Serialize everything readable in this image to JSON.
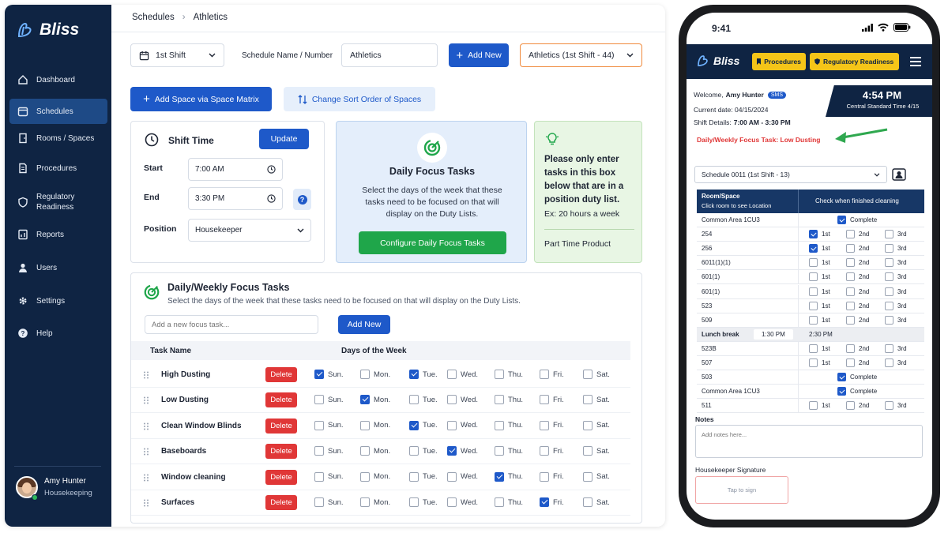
{
  "app": {
    "name": "Bliss",
    "nav": [
      {
        "label": "Dashboard",
        "icon": "dashboard-icon"
      },
      {
        "label": "Schedules",
        "icon": "calendar-icon",
        "active": true
      },
      {
        "label": "Rooms / Spaces",
        "icon": "door-icon"
      },
      {
        "label": "Procedures",
        "icon": "document-icon"
      },
      {
        "label": "Regulatory Readiness",
        "icon": "shield-icon"
      },
      {
        "label": "Reports",
        "icon": "reports-icon"
      },
      {
        "label": "Users",
        "icon": "user-icon"
      },
      {
        "label": "Settings",
        "icon": "gear-icon"
      },
      {
        "label": "Help",
        "icon": "help-icon"
      }
    ],
    "user": {
      "name": "Amy Hunter",
      "role": "Housekeeping"
    }
  },
  "main": {
    "breadcrumb": [
      "Schedules",
      "Athletics"
    ],
    "shift_select": "1st Shift",
    "schedule_label": "Schedule Name / Number",
    "schedule_value": "Athletics",
    "add_new": "Add New",
    "schedule_select": "Athletics (1st Shift - 44)",
    "add_space": "Add Space via Space Matrix",
    "sort_order": "Change Sort Order of Spaces",
    "shift_time": {
      "title": "Shift Time",
      "update": "Update",
      "start_label": "Start",
      "start": "7:00 AM",
      "end_label": "End",
      "end": "3:30 PM",
      "position_label": "Position",
      "position": "Housekeeper"
    },
    "daily_focus": {
      "title": "Daily Focus Tasks",
      "desc": "Select the days of the week that these tasks need to be focused on that will display on the Duty Lists.",
      "button": "Configure Daily Focus Tasks"
    },
    "tip": {
      "text": "Please only enter tasks in this box below that are in a position duty list.",
      "example": "Ex: 20 hours a week",
      "product": "Part Time Product"
    },
    "weekly": {
      "title": "Daily/Weekly Focus Tasks",
      "desc": "Select the days of the week that these tasks need to be focused on that will display on the Duty Lists.",
      "placeholder": "Add a new focus task...",
      "add": "Add New",
      "col_task": "Task Name",
      "col_days": "Days of the Week",
      "days": [
        "Sun.",
        "Mon.",
        "Tue.",
        "Wed.",
        "Thu.",
        "Fri.",
        "Sat."
      ],
      "delete": "Delete",
      "tasks": [
        {
          "name": "High Dusting",
          "checked": [
            0,
            2
          ]
        },
        {
          "name": "Low Dusting",
          "checked": [
            1
          ]
        },
        {
          "name": "Clean Window Blinds",
          "checked": [
            2
          ]
        },
        {
          "name": "Baseboards",
          "checked": [
            3
          ]
        },
        {
          "name": "Window cleaning",
          "checked": [
            4
          ]
        },
        {
          "name": "Surfaces",
          "checked": [
            5
          ]
        }
      ]
    }
  },
  "phone": {
    "time": "9:41",
    "logo": "Bliss",
    "chip_procedures": "Procedures",
    "chip_regulatory": "Regulatory Readiness",
    "welcome_prefix": "Welcome,",
    "welcome_name": "Amy Hunter",
    "sms": "SMS",
    "current_date": "Current date: 04/15/2024",
    "shift_details_prefix": "Shift Details:",
    "shift_details": "7:00 AM - 3:30 PM",
    "clock_time": "4:54 PM",
    "clock_zone": "Central Standard Time 4/15",
    "focus_task": "Daily/Weekly Focus Task: Low Dusting",
    "schedule_select": "Schedule 0011 (1st Shift - 13)",
    "col_room": "Room/Space",
    "col_room_sub": "Click room to see Location",
    "col_check": "Check when finished cleaning",
    "rows": [
      {
        "room": "Common Area 1CU3",
        "type": "complete",
        "checked": true
      },
      {
        "room": "254",
        "type": "shifts",
        "checked": [
          0
        ]
      },
      {
        "room": "256",
        "type": "shifts",
        "checked": [
          0
        ]
      },
      {
        "room": "6011(1)(1)",
        "type": "shifts",
        "checked": []
      },
      {
        "room": "601(1)",
        "type": "shifts",
        "checked": []
      },
      {
        "room": "601(1)",
        "type": "shifts",
        "checked": []
      },
      {
        "room": "523",
        "type": "shifts",
        "checked": []
      },
      {
        "room": "509",
        "type": "shifts",
        "checked": []
      },
      {
        "room": "Lunch break",
        "type": "lunch",
        "from": "1:30 PM",
        "to": "2:30 PM"
      },
      {
        "room": "523B",
        "type": "shifts",
        "checked": []
      },
      {
        "room": "507",
        "type": "shifts",
        "checked": []
      },
      {
        "room": "503",
        "type": "complete",
        "checked": true
      },
      {
        "room": "Common Area 1CU3",
        "type": "complete",
        "checked": true
      },
      {
        "room": "511",
        "type": "shifts",
        "checked": []
      }
    ],
    "shift_labels": [
      "1st",
      "2nd",
      "3rd"
    ],
    "complete_label": "Complete",
    "notes_label": "Notes",
    "notes_placeholder": "Add notes here...",
    "signature_label": "Housekeeper Signature",
    "signature_placeholder": "Tap to sign"
  }
}
